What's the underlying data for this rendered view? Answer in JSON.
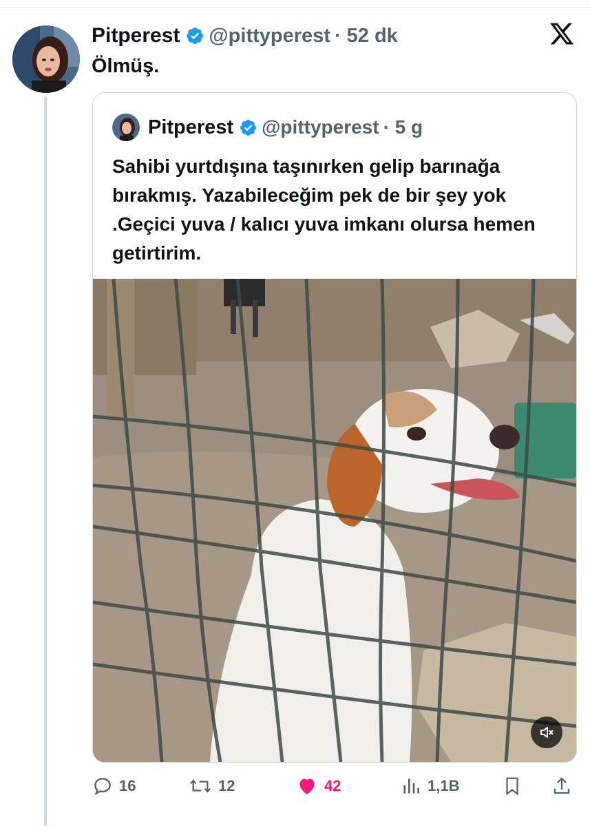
{
  "tweet": {
    "author_name": "Pitperest",
    "handle": "@pittyperest",
    "time": "· 52 dk",
    "text": "Ölmüş."
  },
  "quoted": {
    "author_name": "Pitperest",
    "handle": "@pittyperest",
    "time": "· 5 g",
    "text": "Sahibi yurtdışına taşınırken gelip barınağa bırakmış. Yazabileceğim pek de bir şey yok .Geçici yuva / kalıcı yuva imkanı olursa hemen getirtirim."
  },
  "actions": {
    "replies": "16",
    "retweets": "12",
    "likes": "42",
    "views": "1,1B"
  },
  "colors": {
    "verified": "#1d9bf0",
    "like": "#f91880",
    "muted_text": "#536471"
  },
  "icons": [
    "verified-badge-icon",
    "x-logo-icon",
    "mute-icon",
    "reply-icon",
    "retweet-icon",
    "heart-icon",
    "views-icon",
    "bookmark-icon",
    "share-icon"
  ]
}
